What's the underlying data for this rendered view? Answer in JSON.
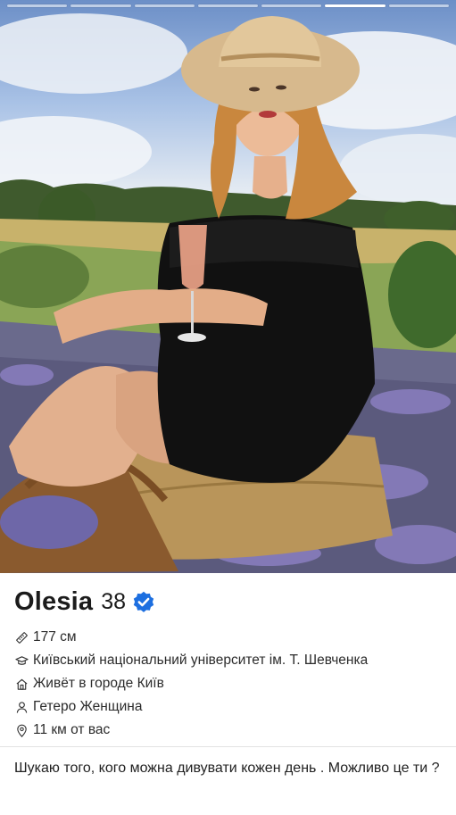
{
  "story": {
    "segments": 7,
    "active_index": 5
  },
  "photo": {
    "description_icon": "profile-photo"
  },
  "profile": {
    "name": "Olesia",
    "age": "38",
    "verified": true,
    "details": [
      {
        "icon": "ruler-icon",
        "text": "177 см"
      },
      {
        "icon": "graduation-cap-icon",
        "text": "Київський національний університет ім. Т. Шевченка"
      },
      {
        "icon": "home-icon",
        "text": "Живёт в городе Київ"
      },
      {
        "icon": "person-icon",
        "text": "Гетеро Женщина"
      },
      {
        "icon": "location-pin-icon",
        "text": "11 км от вас"
      }
    ],
    "bio": "Шукаю того, кого можна дивувати кожен день . Можливо це ти ?"
  },
  "colors": {
    "verified_badge": "#1d6fe0",
    "text": "#222222",
    "divider": "#e2e2e2"
  }
}
